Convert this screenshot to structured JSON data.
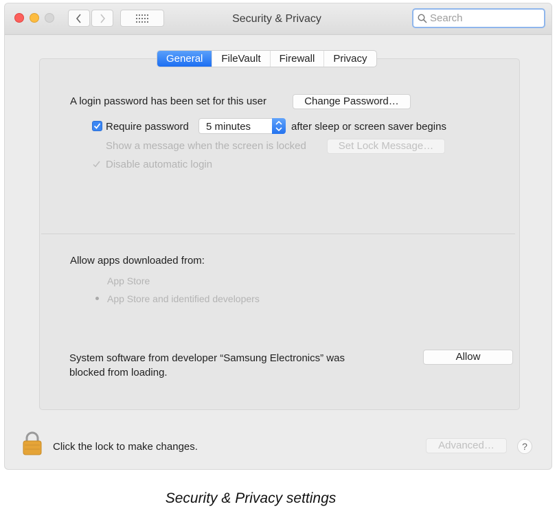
{
  "window": {
    "title": "Security & Privacy",
    "search": {
      "placeholder": "Search",
      "value": ""
    }
  },
  "toolbar": {
    "back_icon": "chevron-left-icon",
    "forward_icon": "chevron-right-icon",
    "show_all_icon": "grid-icon"
  },
  "tabs": [
    {
      "label": "General",
      "active": true
    },
    {
      "label": "FileVault",
      "active": false
    },
    {
      "label": "Firewall",
      "active": false
    },
    {
      "label": "Privacy",
      "active": false
    }
  ],
  "general": {
    "login_text": "A login password has been set for this user",
    "change_password": "Change Password…",
    "require_password": {
      "label": "Require password",
      "checked": true
    },
    "delay": {
      "value": "5 minutes"
    },
    "after_sleep": "after sleep or screen saver begins",
    "show_message": {
      "label": "Show a message when the screen is locked",
      "checked": false,
      "enabled": false
    },
    "set_lock_message": "Set Lock Message…",
    "disable_login": {
      "label": "Disable automatic login",
      "checked": true,
      "enabled": false
    }
  },
  "apps": {
    "heading": "Allow apps downloaded from:",
    "options": [
      {
        "label": "App Store",
        "selected": false
      },
      {
        "label": "App Store and identified developers",
        "selected": true
      }
    ]
  },
  "blocked": {
    "line1": "System software from developer “Samsung Electronics” was",
    "line2": "blocked from loading.",
    "allow": "Allow"
  },
  "footer": {
    "lock_text": "Click the lock to make changes.",
    "advanced": "Advanced…",
    "help": "?"
  },
  "caption": "Security & Privacy settings",
  "colors": {
    "accent": "#1c6ef2",
    "close": "#fc605c",
    "minimize": "#fdbc40",
    "lock": "#e5a437"
  }
}
